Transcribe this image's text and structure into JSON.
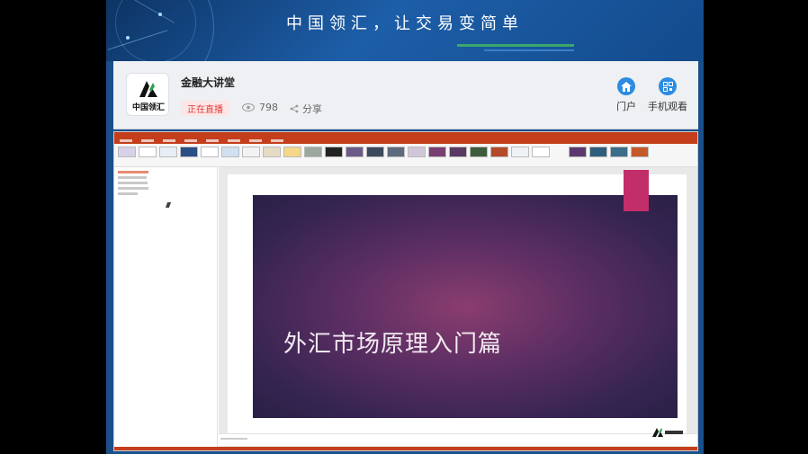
{
  "banner": {
    "slogan": "中国领汇，让交易变简单"
  },
  "channel": {
    "logo_text": "中国领汇",
    "title": "金融大讲堂",
    "live_badge": "正在直播",
    "viewer_count": "798",
    "share_label": "分享"
  },
  "actions": {
    "home_label": "门户",
    "mobile_label": "手机观看"
  },
  "presentation": {
    "slide_title": "外汇市场原理入门篇"
  },
  "colors": {
    "banner_blue": "#1d5ea8",
    "live_red": "#e23c3c",
    "accent_blue": "#2d8ce0",
    "ppt_orange": "#c43e1c",
    "slide_purple": "#5c2e63",
    "bookmark_pink": "#c22e69"
  },
  "icons": {
    "home": "home-icon",
    "mobile": "qr-code-icon",
    "viewers": "viewers-icon",
    "share": "share-icon"
  }
}
